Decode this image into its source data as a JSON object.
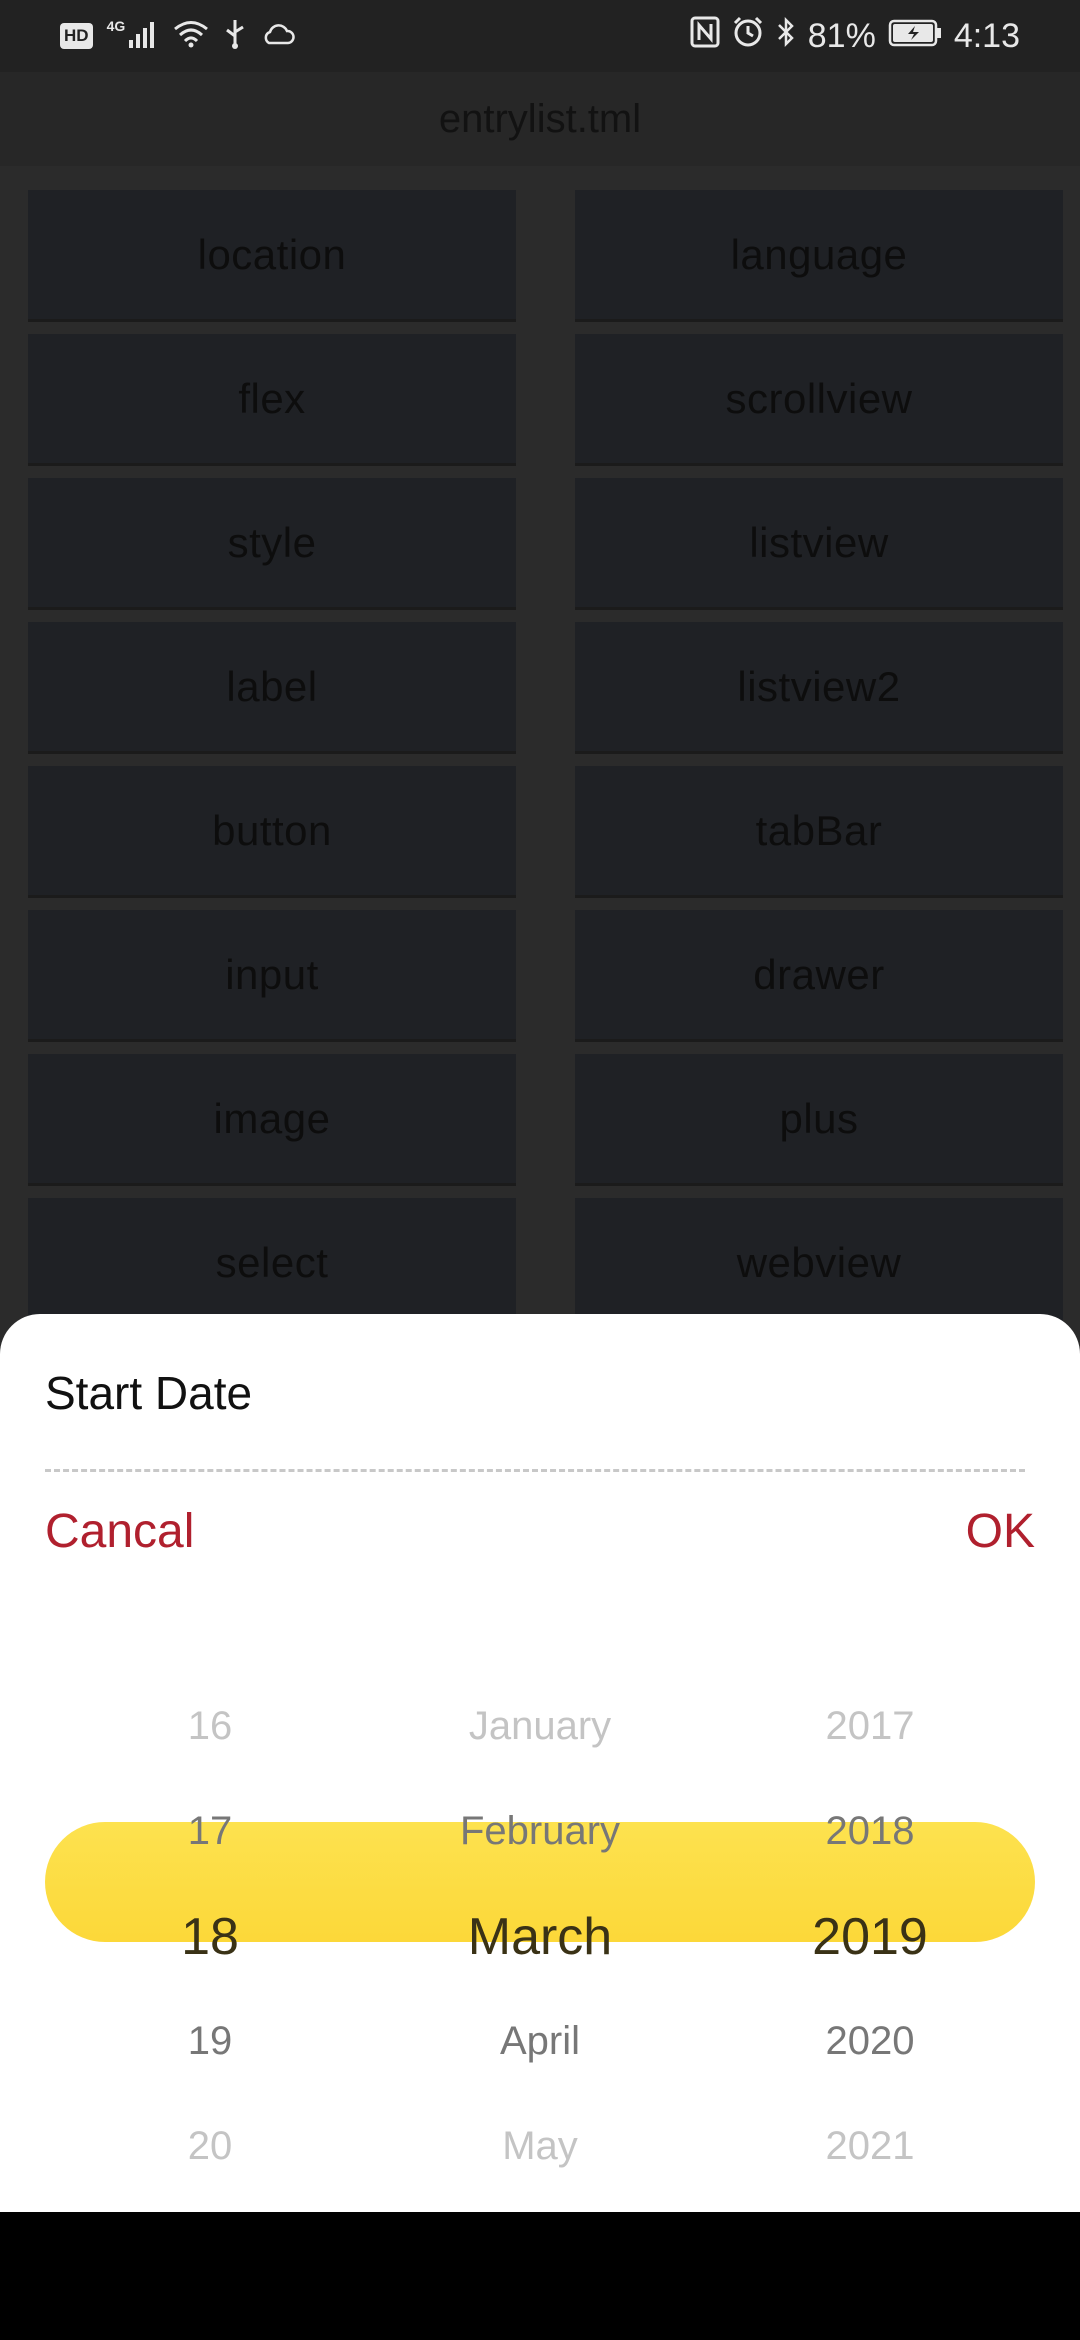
{
  "status_bar": {
    "hd_badge": "HD",
    "network": "4G",
    "battery_percent": "81%",
    "time": "4:13"
  },
  "header": {
    "title": "entrylist.tml"
  },
  "entries": [
    {
      "label": "location"
    },
    {
      "label": "language"
    },
    {
      "label": "flex"
    },
    {
      "label": "scrollview"
    },
    {
      "label": "style"
    },
    {
      "label": "listview"
    },
    {
      "label": "label"
    },
    {
      "label": "listview2"
    },
    {
      "label": "button"
    },
    {
      "label": "tabBar"
    },
    {
      "label": "input"
    },
    {
      "label": "drawer"
    },
    {
      "label": "image"
    },
    {
      "label": "plus"
    },
    {
      "label": "select"
    },
    {
      "label": "webview"
    }
  ],
  "date_picker": {
    "title": "Start Date",
    "cancel_label": "Cancal",
    "ok_label": "OK",
    "days": [
      "16",
      "17",
      "18",
      "19",
      "20"
    ],
    "months": [
      "January",
      "February",
      "March",
      "April",
      "May"
    ],
    "years": [
      "2017",
      "2018",
      "2019",
      "2020",
      "2021"
    ],
    "selected": {
      "day": "18",
      "month": "March",
      "year": "2019"
    }
  },
  "colors": {
    "accent": "#b0202e",
    "highlight": "#fcd839",
    "overlay": "#2b2b2b"
  }
}
